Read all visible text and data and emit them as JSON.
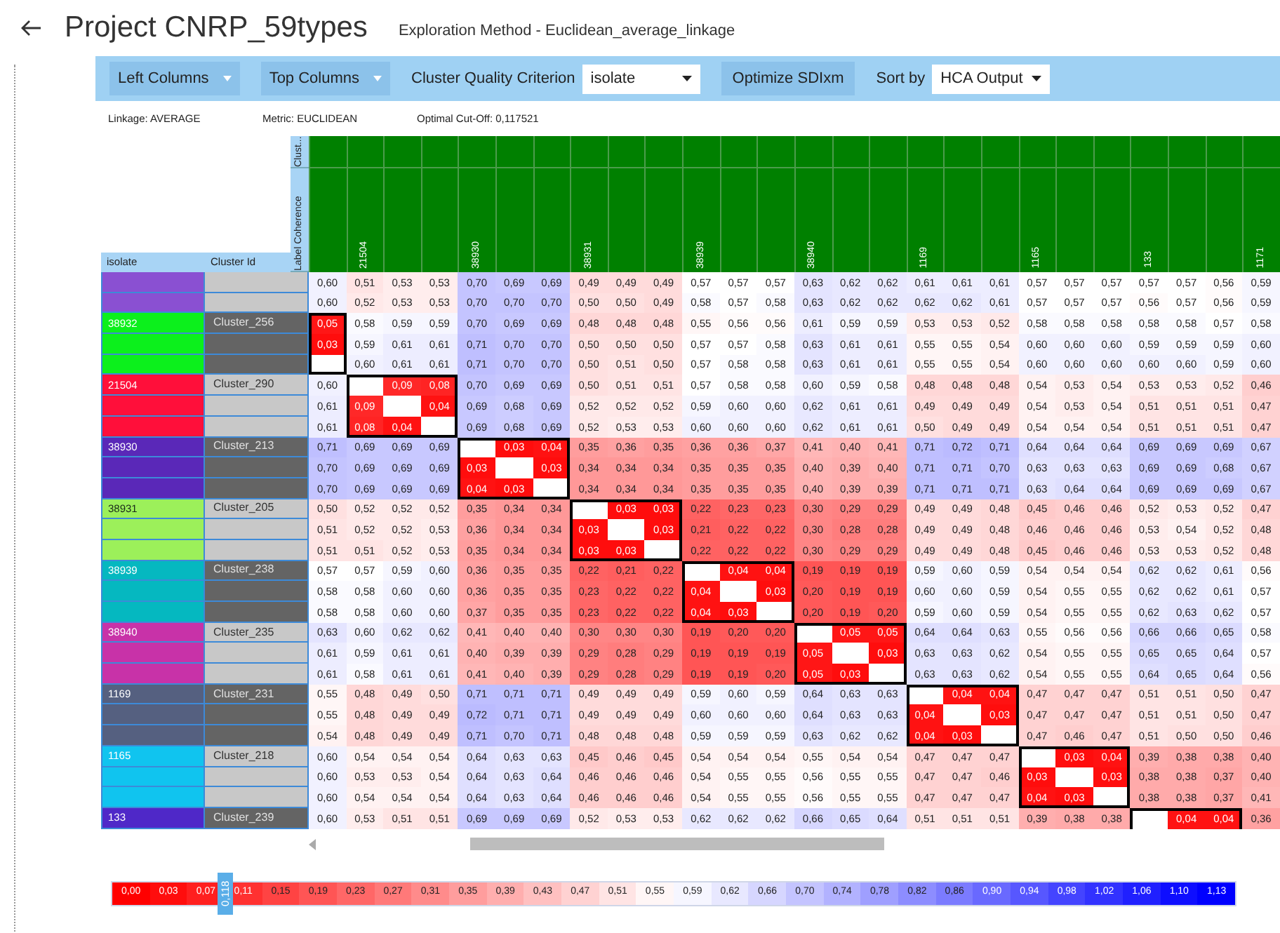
{
  "header": {
    "title": "Project CNRP_59types",
    "subtitle": "Exploration Method - Euclidean_average_linkage"
  },
  "toolbar": [
    {
      "kind": "menu",
      "label": "Left Columns"
    },
    {
      "kind": "menu",
      "label": "Top Columns"
    },
    {
      "kind": "label",
      "label": "Cluster Quality Criterion"
    },
    {
      "kind": "select",
      "label": "isolate"
    },
    {
      "kind": "button",
      "label": "Optimize SDIxm"
    },
    {
      "kind": "label",
      "label": "Sort by"
    },
    {
      "kind": "select",
      "label": "HCA Output"
    }
  ],
  "info": [
    "Linkage: AVERAGE",
    "Metric: EUCLIDEAN",
    "Optimal Cut-Off: 0,117521"
  ],
  "heatmap": {
    "left_headers": [
      "isolate",
      "Cluster Id"
    ],
    "top_headers": [
      "Clust...",
      "Label Coherence"
    ],
    "columns": [
      {
        "kind": "plain"
      },
      {
        "kind": "start",
        "label": "21504"
      },
      {
        "kind": "plain"
      },
      {
        "kind": "plain"
      },
      {
        "kind": "start",
        "label": "38930"
      },
      {
        "kind": "plain"
      },
      {
        "kind": "plain"
      },
      {
        "kind": "start",
        "label": "38931"
      },
      {
        "kind": "plain"
      },
      {
        "kind": "plain"
      },
      {
        "kind": "start",
        "label": "38939"
      },
      {
        "kind": "plain"
      },
      {
        "kind": "plain"
      },
      {
        "kind": "start",
        "label": "38940"
      },
      {
        "kind": "plain"
      },
      {
        "kind": "plain"
      },
      {
        "kind": "start",
        "label": "1169"
      },
      {
        "kind": "plain"
      },
      {
        "kind": "plain"
      },
      {
        "kind": "start",
        "label": "1165"
      },
      {
        "kind": "plain"
      },
      {
        "kind": "plain"
      },
      {
        "kind": "start",
        "label": "133"
      },
      {
        "kind": "plain"
      },
      {
        "kind": "plain"
      },
      {
        "kind": "start",
        "label": "1171"
      }
    ],
    "groups": [
      {
        "isolate": {
          "color": "#8a50d2"
        },
        "cluster": {
          "color": "#c8c8c8"
        },
        "rows": [
          [
            "0,60",
            "0,51",
            "0,53",
            "0,53",
            "0,70",
            "0,69",
            "0,69",
            "0,49",
            "0,49",
            "0,49",
            "0,57",
            "0,57",
            "0,57",
            "0,63",
            "0,62",
            "0,62",
            "0,61",
            "0,61",
            "0,61",
            "0,57",
            "0,57",
            "0,57",
            "0,57",
            "0,57",
            "0,56",
            "0,59"
          ],
          [
            "0,60",
            "0,52",
            "0,53",
            "0,53",
            "0,70",
            "0,70",
            "0,70",
            "0,50",
            "0,50",
            "0,49",
            "0,58",
            "0,57",
            "0,58",
            "0,63",
            "0,62",
            "0,62",
            "0,62",
            "0,62",
            "0,61",
            "0,57",
            "0,57",
            "0,57",
            "0,56",
            "0,57",
            "0,56",
            "0,59"
          ]
        ]
      },
      {
        "isolate": {
          "label": "38932",
          "color": "#0cf01c"
        },
        "cluster": {
          "label": "Cluster_256",
          "color": "#646464"
        },
        "continues": false,
        "rows": [
          [
            "0,05",
            "0,58",
            "0,59",
            "0,59",
            "0,70",
            "0,69",
            "0,69",
            "0,48",
            "0,48",
            "0,48",
            "0,55",
            "0,56",
            "0,56",
            "0,61",
            "0,59",
            "0,59",
            "0,53",
            "0,53",
            "0,52",
            "0,58",
            "0,58",
            "0,58",
            "0,58",
            "0,58",
            "0,57",
            "0,58"
          ],
          [
            "0,03",
            "0,59",
            "0,61",
            "0,61",
            "0,71",
            "0,70",
            "0,70",
            "0,50",
            "0,50",
            "0,50",
            "0,57",
            "0,57",
            "0,58",
            "0,63",
            "0,61",
            "0,61",
            "0,55",
            "0,55",
            "0,54",
            "0,60",
            "0,60",
            "0,60",
            "0,59",
            "0,59",
            "0,59",
            "0,60"
          ],
          [
            null,
            "0,60",
            "0,61",
            "0,61",
            "0,71",
            "0,70",
            "0,70",
            "0,50",
            "0,51",
            "0,50",
            "0,57",
            "0,58",
            "0,58",
            "0,63",
            "0,61",
            "0,61",
            "0,55",
            "0,55",
            "0,54",
            "0,60",
            "0,60",
            "0,60",
            "0,60",
            "0,60",
            "0,59",
            "0,60"
          ]
        ]
      },
      {
        "isolate": {
          "label": "21504",
          "color": "#ff0f3a"
        },
        "cluster": {
          "label": "Cluster_290",
          "color": "#c8c8c8"
        },
        "continues": false,
        "rows": [
          [
            "0,60",
            null,
            "0,09",
            "0,08",
            "0,70",
            "0,69",
            "0,69",
            "0,50",
            "0,51",
            "0,51",
            "0,57",
            "0,58",
            "0,58",
            "0,60",
            "0,59",
            "0,58",
            "0,48",
            "0,48",
            "0,48",
            "0,54",
            "0,53",
            "0,54",
            "0,53",
            "0,53",
            "0,52",
            "0,46"
          ],
          [
            "0,61",
            "0,09",
            null,
            "0,04",
            "0,69",
            "0,68",
            "0,69",
            "0,52",
            "0,52",
            "0,52",
            "0,59",
            "0,60",
            "0,60",
            "0,62",
            "0,61",
            "0,61",
            "0,49",
            "0,49",
            "0,49",
            "0,54",
            "0,53",
            "0,54",
            "0,51",
            "0,51",
            "0,51",
            "0,47"
          ],
          [
            "0,61",
            "0,08",
            "0,04",
            null,
            "0,69",
            "0,68",
            "0,69",
            "0,52",
            "0,53",
            "0,53",
            "0,60",
            "0,60",
            "0,60",
            "0,62",
            "0,61",
            "0,61",
            "0,50",
            "0,49",
            "0,49",
            "0,54",
            "0,54",
            "0,54",
            "0,51",
            "0,51",
            "0,51",
            "0,47"
          ]
        ]
      },
      {
        "isolate": {
          "label": "38930",
          "color": "#5a28b8"
        },
        "cluster": {
          "label": "Cluster_213",
          "color": "#646464"
        },
        "continues": false,
        "rows": [
          [
            "0,71",
            "0,69",
            "0,69",
            "0,69",
            null,
            "0,03",
            "0,04",
            "0,35",
            "0,36",
            "0,35",
            "0,36",
            "0,36",
            "0,37",
            "0,41",
            "0,40",
            "0,41",
            "0,71",
            "0,72",
            "0,71",
            "0,64",
            "0,64",
            "0,64",
            "0,69",
            "0,69",
            "0,69",
            "0,67"
          ],
          [
            "0,70",
            "0,69",
            "0,69",
            "0,69",
            "0,03",
            null,
            "0,03",
            "0,34",
            "0,34",
            "0,34",
            "0,35",
            "0,35",
            "0,35",
            "0,40",
            "0,39",
            "0,40",
            "0,71",
            "0,71",
            "0,70",
            "0,63",
            "0,63",
            "0,63",
            "0,69",
            "0,69",
            "0,68",
            "0,67"
          ],
          [
            "0,70",
            "0,69",
            "0,69",
            "0,69",
            "0,04",
            "0,03",
            null,
            "0,34",
            "0,34",
            "0,34",
            "0,35",
            "0,35",
            "0,35",
            "0,40",
            "0,39",
            "0,39",
            "0,71",
            "0,71",
            "0,71",
            "0,63",
            "0,64",
            "0,64",
            "0,69",
            "0,69",
            "0,69",
            "0,67"
          ]
        ]
      },
      {
        "isolate": {
          "label": "38931",
          "color": "#9cf05a"
        },
        "cluster": {
          "label": "Cluster_205",
          "color": "#c8c8c8"
        },
        "continues": false,
        "rows": [
          [
            "0,50",
            "0,52",
            "0,52",
            "0,52",
            "0,35",
            "0,34",
            "0,34",
            null,
            "0,03",
            "0,03",
            "0,22",
            "0,23",
            "0,23",
            "0,30",
            "0,29",
            "0,29",
            "0,49",
            "0,49",
            "0,48",
            "0,45",
            "0,46",
            "0,46",
            "0,52",
            "0,53",
            "0,52",
            "0,47"
          ],
          [
            "0,51",
            "0,52",
            "0,52",
            "0,53",
            "0,36",
            "0,34",
            "0,34",
            "0,03",
            null,
            "0,03",
            "0,21",
            "0,22",
            "0,22",
            "0,30",
            "0,28",
            "0,28",
            "0,49",
            "0,49",
            "0,48",
            "0,46",
            "0,46",
            "0,46",
            "0,53",
            "0,54",
            "0,52",
            "0,48"
          ],
          [
            "0,51",
            "0,51",
            "0,52",
            "0,53",
            "0,35",
            "0,34",
            "0,34",
            "0,03",
            "0,03",
            null,
            "0,22",
            "0,22",
            "0,22",
            "0,30",
            "0,29",
            "0,29",
            "0,49",
            "0,49",
            "0,48",
            "0,45",
            "0,46",
            "0,46",
            "0,53",
            "0,53",
            "0,52",
            "0,48"
          ]
        ]
      },
      {
        "isolate": {
          "label": "38939",
          "color": "#05b8c0"
        },
        "cluster": {
          "label": "Cluster_238",
          "color": "#646464"
        },
        "continues": false,
        "rows": [
          [
            "0,57",
            "0,57",
            "0,59",
            "0,60",
            "0,36",
            "0,35",
            "0,35",
            "0,22",
            "0,21",
            "0,22",
            null,
            "0,04",
            "0,04",
            "0,19",
            "0,19",
            "0,19",
            "0,59",
            "0,60",
            "0,59",
            "0,54",
            "0,54",
            "0,54",
            "0,62",
            "0,62",
            "0,61",
            "0,56"
          ],
          [
            "0,58",
            "0,58",
            "0,60",
            "0,60",
            "0,36",
            "0,35",
            "0,35",
            "0,23",
            "0,22",
            "0,22",
            "0,04",
            null,
            "0,03",
            "0,20",
            "0,19",
            "0,19",
            "0,60",
            "0,60",
            "0,59",
            "0,54",
            "0,55",
            "0,55",
            "0,62",
            "0,62",
            "0,61",
            "0,57"
          ],
          [
            "0,58",
            "0,58",
            "0,60",
            "0,60",
            "0,37",
            "0,35",
            "0,35",
            "0,23",
            "0,22",
            "0,22",
            "0,04",
            "0,03",
            null,
            "0,20",
            "0,19",
            "0,20",
            "0,59",
            "0,60",
            "0,59",
            "0,54",
            "0,55",
            "0,55",
            "0,62",
            "0,63",
            "0,62",
            "0,57"
          ]
        ]
      },
      {
        "isolate": {
          "label": "38940",
          "color": "#c832a8"
        },
        "cluster": {
          "label": "Cluster_235",
          "color": "#c8c8c8"
        },
        "continues": false,
        "rows": [
          [
            "0,63",
            "0,60",
            "0,62",
            "0,62",
            "0,41",
            "0,40",
            "0,40",
            "0,30",
            "0,30",
            "0,30",
            "0,19",
            "0,20",
            "0,20",
            null,
            "0,05",
            "0,05",
            "0,64",
            "0,64",
            "0,63",
            "0,55",
            "0,56",
            "0,56",
            "0,66",
            "0,66",
            "0,65",
            "0,58"
          ],
          [
            "0,61",
            "0,59",
            "0,61",
            "0,61",
            "0,40",
            "0,39",
            "0,39",
            "0,29",
            "0,28",
            "0,29",
            "0,19",
            "0,19",
            "0,19",
            "0,05",
            null,
            "0,03",
            "0,63",
            "0,63",
            "0,62",
            "0,54",
            "0,55",
            "0,55",
            "0,65",
            "0,65",
            "0,64",
            "0,57"
          ],
          [
            "0,61",
            "0,58",
            "0,61",
            "0,61",
            "0,41",
            "0,40",
            "0,39",
            "0,29",
            "0,28",
            "0,29",
            "0,19",
            "0,19",
            "0,20",
            "0,05",
            "0,03",
            null,
            "0,63",
            "0,63",
            "0,62",
            "0,54",
            "0,55",
            "0,55",
            "0,64",
            "0,65",
            "0,64",
            "0,56"
          ]
        ]
      },
      {
        "isolate": {
          "label": "1169",
          "color": "#556080"
        },
        "cluster": {
          "label": "Cluster_231",
          "color": "#646464"
        },
        "continues": false,
        "rows": [
          [
            "0,55",
            "0,48",
            "0,49",
            "0,50",
            "0,71",
            "0,71",
            "0,71",
            "0,49",
            "0,49",
            "0,49",
            "0,59",
            "0,60",
            "0,59",
            "0,64",
            "0,63",
            "0,63",
            null,
            "0,04",
            "0,04",
            "0,47",
            "0,47",
            "0,47",
            "0,51",
            "0,51",
            "0,50",
            "0,47"
          ],
          [
            "0,55",
            "0,48",
            "0,49",
            "0,49",
            "0,72",
            "0,71",
            "0,71",
            "0,49",
            "0,49",
            "0,49",
            "0,60",
            "0,60",
            "0,60",
            "0,64",
            "0,63",
            "0,63",
            "0,04",
            null,
            "0,03",
            "0,47",
            "0,47",
            "0,47",
            "0,51",
            "0,51",
            "0,50",
            "0,47"
          ],
          [
            "0,54",
            "0,48",
            "0,49",
            "0,49",
            "0,71",
            "0,70",
            "0,71",
            "0,48",
            "0,48",
            "0,48",
            "0,59",
            "0,59",
            "0,59",
            "0,63",
            "0,62",
            "0,62",
            "0,04",
            "0,03",
            null,
            "0,47",
            "0,46",
            "0,47",
            "0,51",
            "0,50",
            "0,50",
            "0,46"
          ]
        ]
      },
      {
        "isolate": {
          "label": "1165",
          "color": "#10c4ef"
        },
        "cluster": {
          "label": "Cluster_218",
          "color": "#c8c8c8"
        },
        "continues": false,
        "rows": [
          [
            "0,60",
            "0,54",
            "0,54",
            "0,54",
            "0,64",
            "0,63",
            "0,63",
            "0,45",
            "0,46",
            "0,45",
            "0,54",
            "0,54",
            "0,54",
            "0,55",
            "0,54",
            "0,54",
            "0,47",
            "0,47",
            "0,47",
            null,
            "0,03",
            "0,04",
            "0,39",
            "0,38",
            "0,38",
            "0,40"
          ],
          [
            "0,60",
            "0,53",
            "0,53",
            "0,54",
            "0,64",
            "0,63",
            "0,64",
            "0,46",
            "0,46",
            "0,46",
            "0,54",
            "0,55",
            "0,55",
            "0,56",
            "0,55",
            "0,55",
            "0,47",
            "0,47",
            "0,46",
            "0,03",
            null,
            "0,03",
            "0,38",
            "0,38",
            "0,37",
            "0,40"
          ],
          [
            "0,60",
            "0,54",
            "0,54",
            "0,54",
            "0,64",
            "0,63",
            "0,64",
            "0,46",
            "0,46",
            "0,46",
            "0,54",
            "0,55",
            "0,55",
            "0,56",
            "0,55",
            "0,55",
            "0,47",
            "0,47",
            "0,47",
            "0,04",
            "0,03",
            null,
            "0,38",
            "0,38",
            "0,37",
            "0,41"
          ]
        ]
      },
      {
        "isolate": {
          "label": "133",
          "color": "#4f28c8"
        },
        "cluster": {
          "label": "Cluster_239",
          "color": "#646464"
        },
        "continues": true,
        "rows": [
          [
            "0,60",
            "0,53",
            "0,51",
            "0,51",
            "0,69",
            "0,69",
            "0,69",
            "0,52",
            "0,53",
            "0,53",
            "0,62",
            "0,62",
            "0,62",
            "0,66",
            "0,65",
            "0,64",
            "0,51",
            "0,51",
            "0,51",
            "0,39",
            "0,38",
            "0,38",
            null,
            "0,04",
            "0,04",
            "0,36"
          ]
        ]
      }
    ]
  },
  "legend": {
    "values": [
      "0,00",
      "0,03",
      "0,07",
      "0,11",
      "0,15",
      "0,19",
      "0,23",
      "0,27",
      "0,31",
      "0,35",
      "0,39",
      "0,43",
      "0,47",
      "0,51",
      "0,55",
      "0,59",
      "0,62",
      "0,66",
      "0,70",
      "0,74",
      "0,78",
      "0,82",
      "0,86",
      "0,90",
      "0,94",
      "0,98",
      "1,02",
      "1,06",
      "1,10",
      "1,13"
    ],
    "marker": {
      "label": "0,118",
      "level": 0.1
    }
  }
}
